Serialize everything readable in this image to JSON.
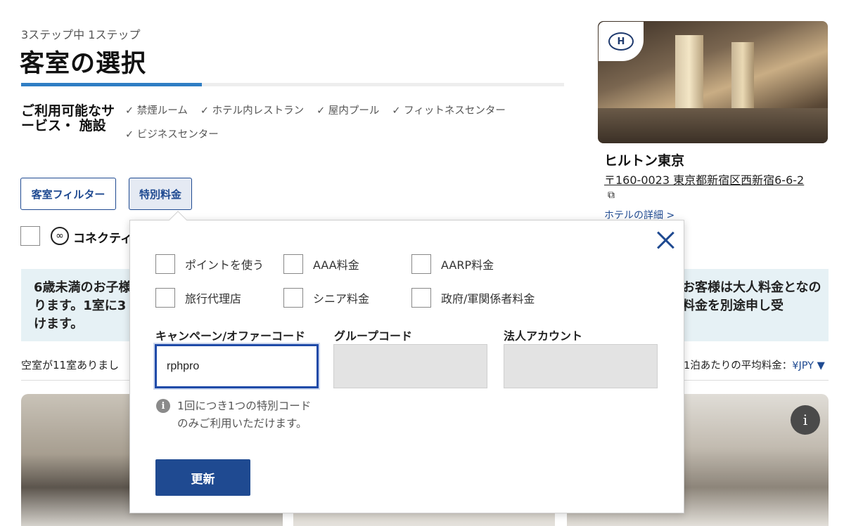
{
  "header": {
    "step_text": "3ステップ中 1ステップ",
    "title": "客室の選択",
    "progress_fraction": 0.333
  },
  "amenities": {
    "heading": "ご利用可能なサービス・ 施設",
    "items": [
      "✓ 禁煙ルーム",
      "✓ ホテル内レストラン",
      "✓ 屋内プール",
      "✓ フィットネスセンター",
      "✓ ビジネスセンター"
    ]
  },
  "filters": {
    "room_filter_label": "客室フィルター",
    "special_rates_label": "特別料金",
    "connecting_label": "コネクティ"
  },
  "notice": {
    "left_text": "6歳未満のお子様は1室につき1名まで添い寝無料となります。1室に3名以上ご宿泊の場合は別料金となる場合がございます。ご予約の詳細はホテルへお問い合わせいただけます。",
    "left_visible": "6歳未満のお子様ります。1室に3けます。",
    "right_visible": "お客様は大人料金となの料金を別途申し受"
  },
  "listing": {
    "rooms_available": "空室が11室ありまし",
    "avg_rate_label": "1泊あたりの平均料金：",
    "currency": "¥JPY ▼"
  },
  "hotel": {
    "name": "ヒルトン東京",
    "address": "〒160-0023 東京都新宿区西新宿6-6-2",
    "external_icon": "external-link-icon",
    "details_link": "ホテルの詳細 >",
    "logo_text": "H"
  },
  "popup": {
    "options": [
      {
        "label": "ポイントを使う",
        "checked": false
      },
      {
        "label": "AAA料金",
        "checked": false
      },
      {
        "label": "AARP料金",
        "checked": false
      },
      {
        "label": "旅行代理店",
        "checked": false
      },
      {
        "label": "シニア料金",
        "checked": false
      },
      {
        "label": "政府/軍関係者料金",
        "checked": false
      }
    ],
    "campaign_label": "キャンペーン/オファーコード",
    "campaign_value": "rphpro",
    "group_label": "グループコード",
    "group_value": "",
    "corporate_label": "法人アカウント",
    "corporate_value": "",
    "hint_icon": "i",
    "hint": "1回につき1つの特別コードのみご利用いただけます。",
    "update_label": "更新"
  },
  "room_info_icon": "i",
  "colors": {
    "brand_blue": "#1f4a91",
    "progress_blue": "#2f7ec4",
    "notice_bg": "#e6f1f5"
  }
}
